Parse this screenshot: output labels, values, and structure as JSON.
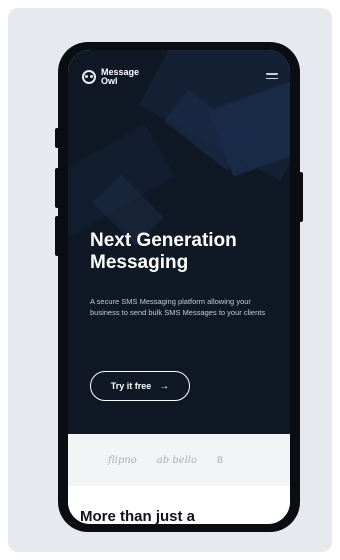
{
  "brand": {
    "name_line1": "Message",
    "name_line2": "Owl",
    "logo_icon": "owl-icon"
  },
  "nav": {
    "menu_icon": "hamburger-menu-icon"
  },
  "hero": {
    "headline": "Next Generation Messaging",
    "description": "A secure SMS Messaging platform allowing your business to send bulk SMS Messages to your clients",
    "cta_label": "Try it free",
    "cta_icon": "arrow-right-icon"
  },
  "clients": [
    "",
    "flipno",
    "ab bello",
    "B"
  ],
  "section": {
    "title": "More than just a"
  },
  "colors": {
    "hero_bg": "#0f1824",
    "card_bg": "#e6e9ed",
    "logos_bg": "#f2f4f6"
  }
}
